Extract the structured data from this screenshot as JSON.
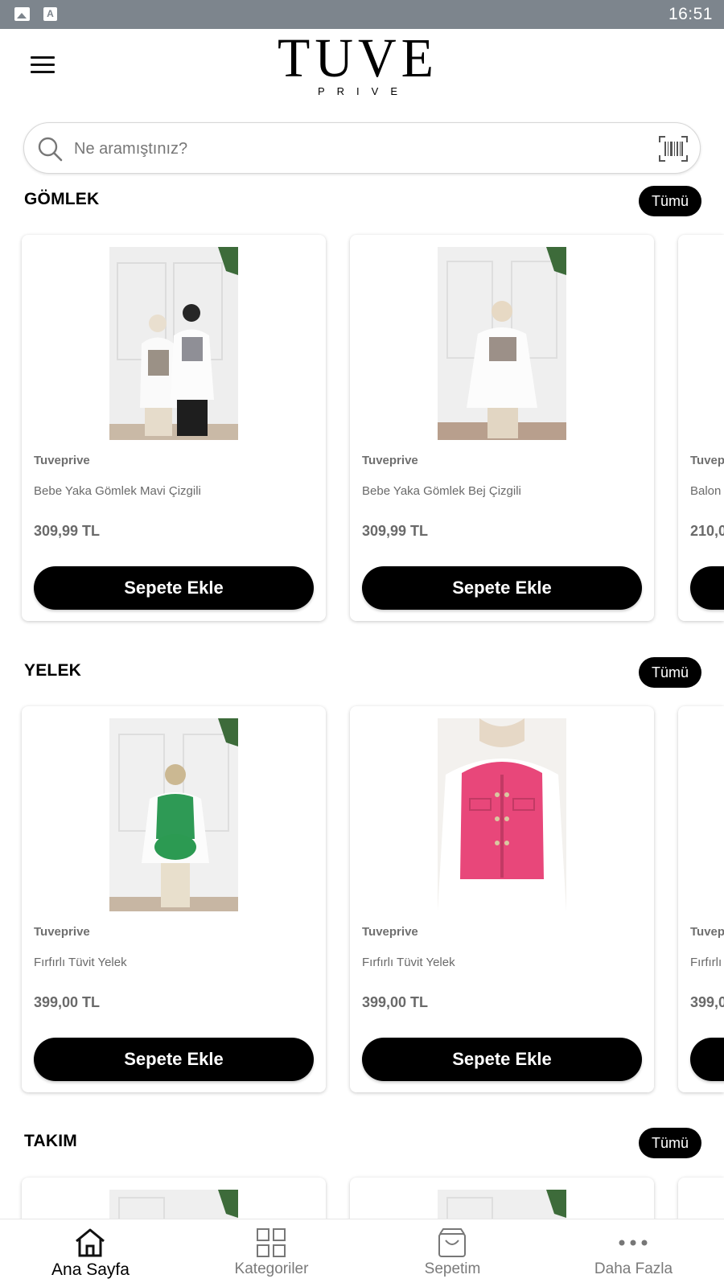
{
  "status_bar": {
    "time": "16:51",
    "icons": [
      "image-icon",
      "a-icon"
    ]
  },
  "header": {
    "menu_icon": "hamburger-menu-icon",
    "logo_main": "TUVE",
    "logo_sub": "PRIVE"
  },
  "search": {
    "placeholder": "Ne aramıştınız?",
    "value": "",
    "barcode_icon": "barcode-scan-icon"
  },
  "sections": [
    {
      "title": "GÖMLEK",
      "all_label": "Tümü",
      "cards": [
        {
          "brand": "Tuveprive",
          "name": "Bebe Yaka Gömlek Mavi Çizgili",
          "price": "309,99 TL",
          "button": "Sepete Ekle"
        },
        {
          "brand": "Tuveprive",
          "name": "Bebe Yaka Gömlek Bej Çizgili",
          "price": "309,99 TL",
          "button": "Sepete Ekle"
        },
        {
          "brand": "Tuvep",
          "name": "Balon",
          "price": "210,0",
          "button": ""
        }
      ]
    },
    {
      "title": "YELEK",
      "all_label": "Tümü",
      "cards": [
        {
          "brand": "Tuveprive",
          "name": "Fırfırlı Tüvit Yelek",
          "price": "399,00 TL",
          "button": "Sepete Ekle"
        },
        {
          "brand": "Tuveprive",
          "name": "Fırfırlı Tüvit Yelek",
          "price": "399,00 TL",
          "button": "Sepete Ekle"
        },
        {
          "brand": "Tuvep",
          "name": "Fırfırlı",
          "price": "399,0",
          "button": ""
        }
      ]
    },
    {
      "title": "TAKIM",
      "all_label": "Tümü",
      "cards": []
    }
  ],
  "bottom_nav": [
    {
      "label": "Ana Sayfa",
      "icon": "home-icon",
      "active": true
    },
    {
      "label": "Kategoriler",
      "icon": "grid-icon",
      "active": false
    },
    {
      "label": "Sepetim",
      "icon": "shopping-bag-icon",
      "active": false
    },
    {
      "label": "Daha Fazla",
      "icon": "more-dots-icon",
      "active": false
    }
  ],
  "colors": {
    "accent": "#000000",
    "status_bar": "#7d858d",
    "muted_text": "#6a6a6a",
    "vest_green": "#2e9a55",
    "vest_pink": "#e8477a"
  }
}
